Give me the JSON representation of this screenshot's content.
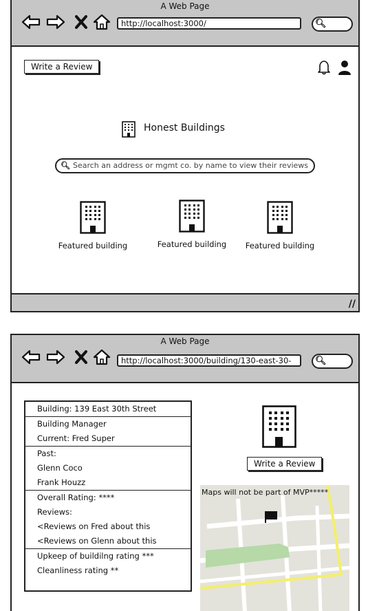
{
  "window1": {
    "page_title": "A Web Page",
    "url": "http://localhost:3000/",
    "write_review_label": "Write a Review",
    "brand_name": "Honest Buildings",
    "search_placeholder": "Search an address or mgmt co. by name to view their reviews",
    "featured": [
      {
        "label": "Featured building"
      },
      {
        "label": "Featured building"
      },
      {
        "label": "Featured building"
      }
    ]
  },
  "window2": {
    "page_title": "A Web Page",
    "url": "http://localhost:3000/building/130-east-30-",
    "write_review_label": "Write a Review",
    "map_caption": "Maps will not be part of MVP*****",
    "info": {
      "building": "Building: 139 East 30th Street",
      "manager_heading": "Building Manager",
      "current": "Current: Fred Super",
      "past_heading": "Past:",
      "past1": "Glenn Coco",
      "past2": "Frank Houzz",
      "overall": "Overall Rating: ****",
      "reviews_heading": "Reviews:",
      "review1": "<Reviews on Fred about this",
      "review2": "<Reviews on Glenn about this",
      "upkeep": "Upkeep of buildilng rating ***",
      "cleanliness": "Cleanliness rating **"
    }
  },
  "icons": {
    "back": "back-arrow-icon",
    "forward": "forward-arrow-icon",
    "stop": "close-icon",
    "home": "home-icon",
    "search": "search-icon",
    "bell": "bell-icon",
    "user": "user-icon",
    "building": "building-icon",
    "flag": "flag-icon"
  }
}
